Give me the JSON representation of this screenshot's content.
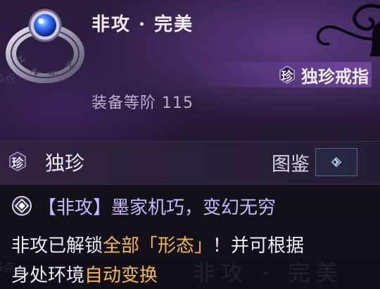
{
  "item": {
    "name": "非攻 · 完美",
    "rarity_badge": "珍",
    "rarity_label": "独珍戒指",
    "gear_level": "装备等阶 115",
    "ghost_text": "5点"
  },
  "tier": {
    "badge": "珍",
    "label": "独珍",
    "codex_label": "图鉴",
    "codex_icon": "chevron-right-icon"
  },
  "description": {
    "skill_title": "【非攻】墨家机巧，变幻无穷",
    "line1": {
      "a": "非攻已解锁",
      "b": "全部「形态」",
      "c": "！并可根据"
    },
    "line2": {
      "a": "身处环境",
      "b": "自动变换"
    },
    "ghost_text": "非攻 · 完美",
    "ghost_num": "5点"
  },
  "colors": {
    "accent_purple": "#cdb6ff",
    "highlight_gold": "#f2b94a",
    "codex_border": "#4c6b8a"
  }
}
